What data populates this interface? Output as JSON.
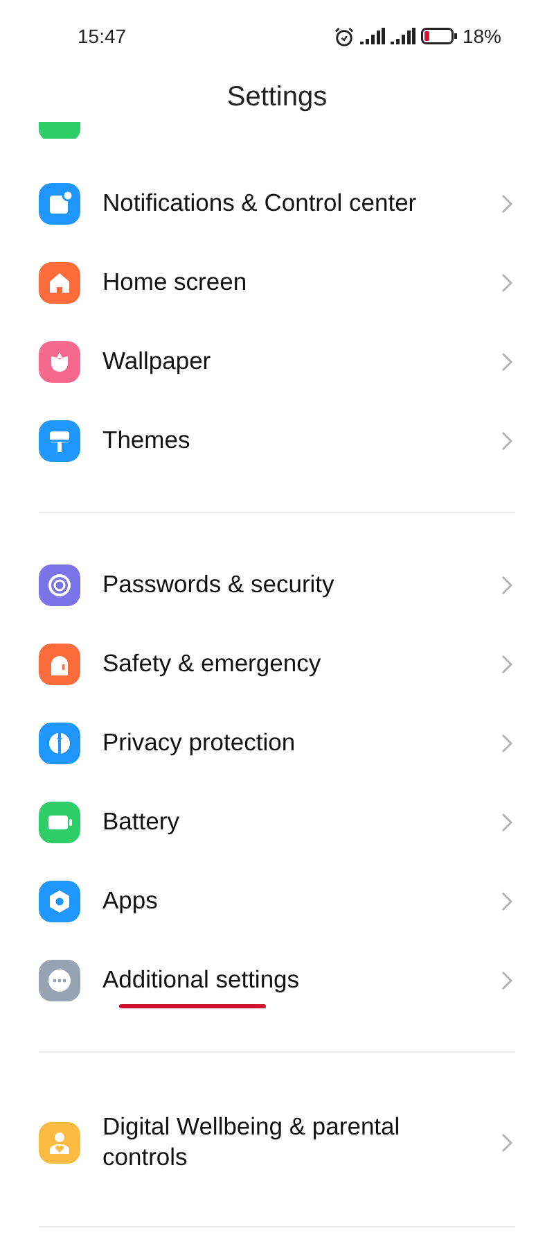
{
  "status_bar": {
    "time": "15:47",
    "battery_percent": "18%",
    "battery": {
      "level": 0.18
    }
  },
  "title": "Settings",
  "groups": [
    {
      "items": [
        {
          "label": "Notifications & Control center",
          "kind": "notifications",
          "color": "#1e96fa",
          "underlined": false
        },
        {
          "label": "Home screen",
          "kind": "home",
          "color": "#fb6c3c",
          "underlined": false
        },
        {
          "label": "Wallpaper",
          "kind": "wallpaper",
          "color": "#f6698e",
          "underlined": false
        },
        {
          "label": "Themes",
          "kind": "themes",
          "color": "#1e96fa",
          "underlined": false
        }
      ]
    },
    {
      "items": [
        {
          "label": "Passwords & security",
          "kind": "passwords",
          "color": "#7b74e8",
          "underlined": false
        },
        {
          "label": "Safety & emergency",
          "kind": "safety",
          "color": "#fb6c3c",
          "underlined": false
        },
        {
          "label": "Privacy protection",
          "kind": "privacy",
          "color": "#1e96fa",
          "underlined": false
        },
        {
          "label": "Battery",
          "kind": "battery",
          "color": "#2fcd6a",
          "underlined": false
        },
        {
          "label": "Apps",
          "kind": "apps",
          "color": "#1e96fa",
          "underlined": false
        },
        {
          "label": "Additional settings",
          "kind": "more",
          "color": "#95a3b3",
          "underlined": true
        }
      ]
    },
    {
      "items": [
        {
          "label": "Digital Wellbeing & parental controls",
          "kind": "wellbeing",
          "color": "#fbbb42",
          "underlined": false
        }
      ]
    }
  ]
}
